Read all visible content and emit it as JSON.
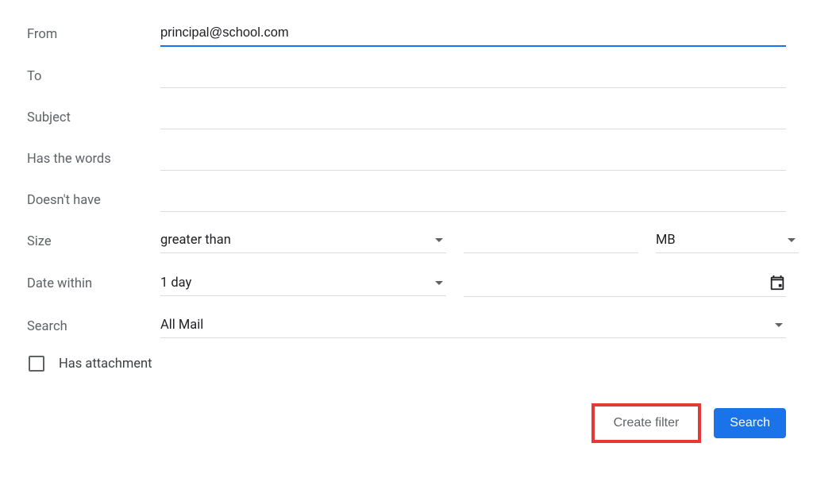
{
  "labels": {
    "from": "From",
    "to": "To",
    "subject": "Subject",
    "hasWords": "Has the words",
    "doesntHave": "Doesn't have",
    "size": "Size",
    "dateWithin": "Date within",
    "search": "Search",
    "hasAttachment": "Has attachment"
  },
  "values": {
    "from": "principal@school.com",
    "to": "",
    "subject": "",
    "hasWords": "",
    "doesntHave": "",
    "sizeComparator": "greater than",
    "sizeValue": "",
    "sizeUnit": "MB",
    "dateRange": "1 day",
    "dateValue": "",
    "searchScope": "All Mail",
    "hasAttachmentChecked": false
  },
  "buttons": {
    "createFilter": "Create filter",
    "search": "Search"
  }
}
